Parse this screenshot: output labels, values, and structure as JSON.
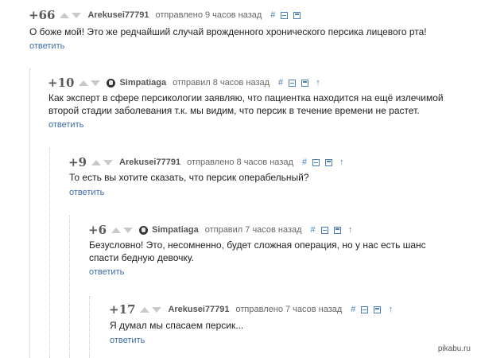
{
  "comments": [
    {
      "rating": "+66",
      "username": "Arekusei77791",
      "time": "отправлено 9 часов назад",
      "text": "О боже мой! Это же редчайший случай врожденного хронического персика лицевого рта!",
      "reply": "ответить",
      "has_avatar": false,
      "has_up_icon": false
    },
    {
      "rating": "+10",
      "username": "Simpatiaga",
      "time": "отправил 8 часов назад",
      "text": "Как эксперт в сфере персикологии заявляю, что пациентка находится на ещё излечимой второй стадии заболевания т.к. мы видим, что персик в течение времени не растет.",
      "reply": "ответить",
      "has_avatar": true,
      "has_up_icon": true
    },
    {
      "rating": "+9",
      "username": "Arekusei77791",
      "time": "отправлено 8 часов назад",
      "text": "То есть вы хотите сказать, что персик операбельный?",
      "reply": "ответить",
      "has_avatar": false,
      "has_up_icon": true
    },
    {
      "rating": "+6",
      "username": "Simpatiaga",
      "time": "отправил 7 часов назад",
      "text": "Безусловно! Это, несомненно, будет сложная операция, но у нас есть шанс спасти бедную девочку.",
      "reply": "ответить",
      "has_avatar": true,
      "has_up_icon": true
    },
    {
      "rating": "+17",
      "username": "Arekusei77791",
      "time": "отправлено 7 часов назад",
      "text": "Я думал мы спасаем персик...",
      "reply": "ответить",
      "has_avatar": false,
      "has_up_icon": true
    }
  ],
  "icons": {
    "link": "#",
    "up": "↑"
  },
  "watermark": "pikabu.ru"
}
